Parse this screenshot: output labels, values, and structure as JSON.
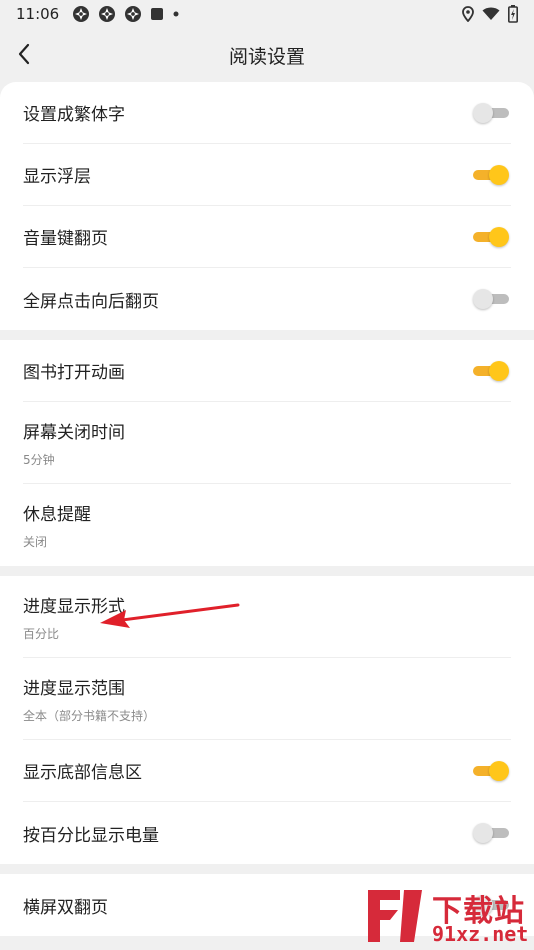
{
  "status_bar": {
    "time": "11:06"
  },
  "header": {
    "title": "阅读设置"
  },
  "sections": [
    {
      "items": [
        {
          "label": "设置成繁体字",
          "toggle": "off"
        },
        {
          "label": "显示浮层",
          "toggle": "on"
        },
        {
          "label": "音量键翻页",
          "toggle": "on"
        },
        {
          "label": "全屏点击向后翻页",
          "toggle": "off"
        }
      ]
    },
    {
      "items": [
        {
          "label": "图书打开动画",
          "toggle": "on"
        },
        {
          "label": "屏幕关闭时间",
          "sub": "5分钟"
        },
        {
          "label": "休息提醒",
          "sub": "关闭"
        }
      ]
    },
    {
      "items": [
        {
          "label": "进度显示形式",
          "sub": "百分比"
        },
        {
          "label": "进度显示范围",
          "sub": "全本（部分书籍不支持）"
        },
        {
          "label": "显示底部信息区",
          "toggle": "on"
        },
        {
          "label": "按百分比显示电量",
          "toggle": "off"
        }
      ]
    },
    {
      "items": [
        {
          "label": "横屏双翻页",
          "toggle": "off"
        }
      ]
    }
  ],
  "watermark": {
    "brand": "下载站",
    "domain": "91xz.net"
  },
  "colors": {
    "accent": "#ffc61a",
    "annotation_arrow": "#e0202a",
    "watermark": "#d62a3a"
  }
}
